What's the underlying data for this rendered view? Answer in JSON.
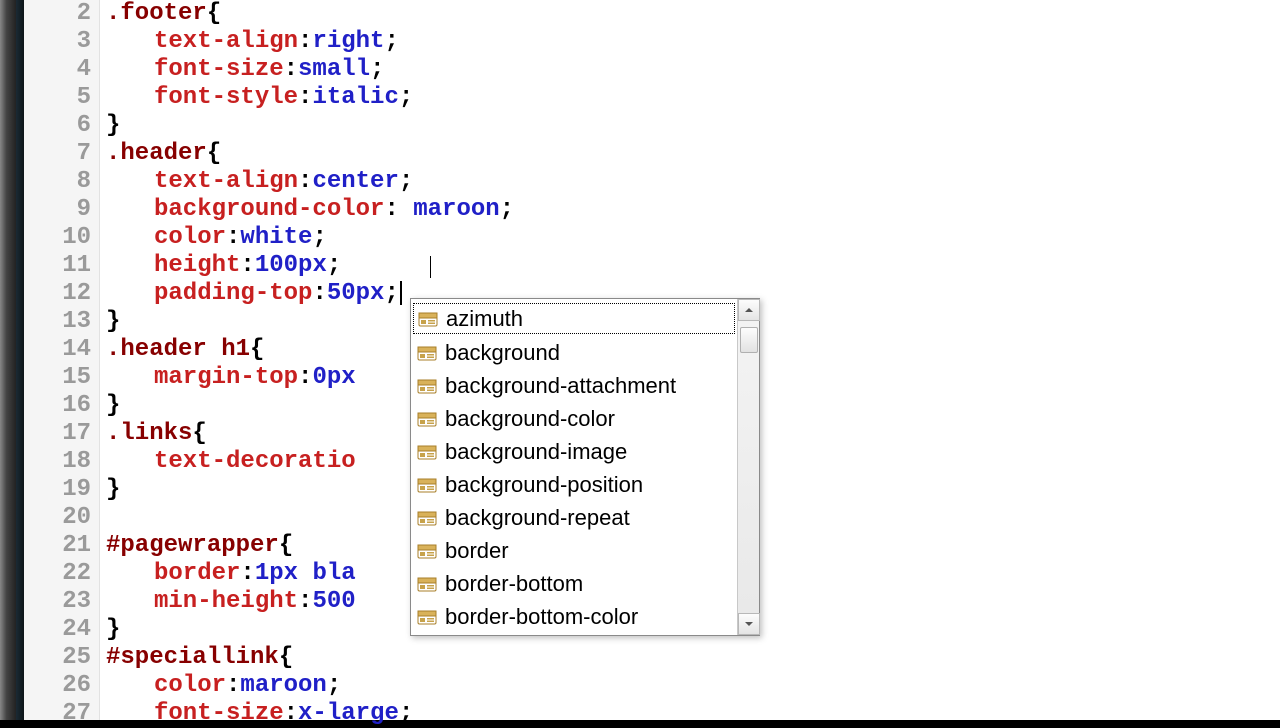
{
  "editor": {
    "first_line_number": 2,
    "lines": [
      {
        "kind": "sel-open",
        "selector": ".footer",
        "open": "{"
      },
      {
        "kind": "decl",
        "prop": "text-align",
        "val": "right"
      },
      {
        "kind": "decl",
        "prop": "font-size",
        "val": "small"
      },
      {
        "kind": "decl",
        "prop": "font-style",
        "val": "italic"
      },
      {
        "kind": "close"
      },
      {
        "kind": "sel-open",
        "selector": ".header",
        "open": "{"
      },
      {
        "kind": "decl",
        "prop": "text-align",
        "val": "center"
      },
      {
        "kind": "decl-sp",
        "prop": "background-color",
        "val": "maroon"
      },
      {
        "kind": "decl",
        "prop": "color",
        "val": "white"
      },
      {
        "kind": "decl",
        "prop": "height",
        "val": "100px"
      },
      {
        "kind": "decl-cursor",
        "prop": "padding-top",
        "val": "50px"
      },
      {
        "kind": "close"
      },
      {
        "kind": "sel-open",
        "selector": ".header h1",
        "open": "{"
      },
      {
        "kind": "decl-trunc",
        "prop": "margin-top",
        "val": "0px"
      },
      {
        "kind": "close"
      },
      {
        "kind": "sel-open",
        "selector": ".links",
        "open": "{"
      },
      {
        "kind": "decl-trunc2",
        "prop": "text-decoratio"
      },
      {
        "kind": "close"
      },
      {
        "kind": "blank"
      },
      {
        "kind": "sel-open",
        "selector": "#pagewrapper",
        "open": "{"
      },
      {
        "kind": "decl-trunc3",
        "prop": "border",
        "val": "1px bla"
      },
      {
        "kind": "decl-trunc3",
        "prop": "min-height",
        "val": "500"
      },
      {
        "kind": "close"
      },
      {
        "kind": "sel-open",
        "selector": "#speciallink",
        "open": "{"
      },
      {
        "kind": "decl",
        "prop": "color",
        "val": "maroon"
      },
      {
        "kind": "decl",
        "prop": "font-size",
        "val": "x-large"
      }
    ]
  },
  "autocomplete": {
    "selected_index": 0,
    "items": [
      "azimuth",
      "background",
      "background-attachment",
      "background-color",
      "background-image",
      "background-position",
      "background-repeat",
      "border",
      "border-bottom",
      "border-bottom-color"
    ]
  }
}
